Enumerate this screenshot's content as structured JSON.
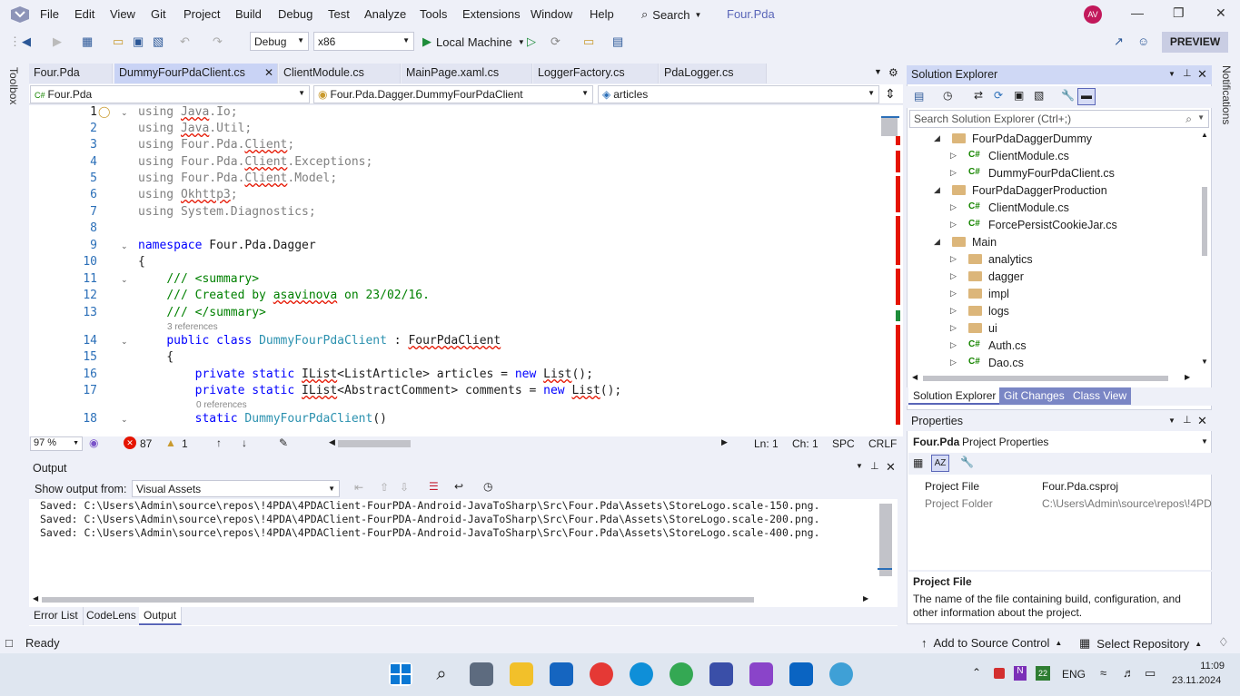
{
  "menubar": {
    "items": [
      "File",
      "Edit",
      "View",
      "Git",
      "Project",
      "Build",
      "Debug",
      "Test",
      "Analyze",
      "Tools",
      "Extensions",
      "Window",
      "Help"
    ],
    "search_label": "Search",
    "project_name": "Four.Pda"
  },
  "toolbar": {
    "config": "Debug",
    "platform": "x86",
    "run_target": "Local Machine",
    "preview_label": "PREVIEW"
  },
  "rails": {
    "toolbox": "Toolbox",
    "notifications": "Notifications"
  },
  "editor": {
    "tabs": [
      "Four.Pda",
      "DummyFourPdaClient.cs",
      "ClientModule.cs",
      "MainPage.xaml.cs",
      "LoggerFactory.cs",
      "PdaLogger.cs"
    ],
    "nav": {
      "project": "Four.Pda",
      "type": "Four.Pda.Dagger.DummyFourPdaClient",
      "member": "articles"
    },
    "references_3": "3 references",
    "references_0": "0 references",
    "status": {
      "zoom": "97 %",
      "errors": "87",
      "warnings": "1",
      "ln": "Ln: 1",
      "ch": "Ch: 1",
      "spc": "SPC",
      "crlf": "CRLF"
    }
  },
  "output": {
    "title": "Output",
    "show_from_label": "Show output from:",
    "source": "Visual Assets",
    "lines": [
      "Saved: C:\\Users\\Admin\\source\\repos\\!4PDA\\4PDAClient-FourPDA-Android-JavaToSharp\\Src\\Four.Pda\\Assets\\StoreLogo.scale-150.png.",
      "Saved: C:\\Users\\Admin\\source\\repos\\!4PDA\\4PDAClient-FourPDA-Android-JavaToSharp\\Src\\Four.Pda\\Assets\\StoreLogo.scale-200.png.",
      "Saved: C:\\Users\\Admin\\source\\repos\\!4PDA\\4PDAClient-FourPDA-Android-JavaToSharp\\Src\\Four.Pda\\Assets\\StoreLogo.scale-400.png."
    ],
    "tabs": [
      "Error List",
      "CodeLens",
      "Output"
    ]
  },
  "solution_explorer": {
    "title": "Solution Explorer",
    "search_placeholder": "Search Solution Explorer (Ctrl+;)",
    "tree": [
      {
        "label": "FourPdaDaggerDummy",
        "kind": "folder",
        "depth": 0,
        "open": true
      },
      {
        "label": "ClientModule.cs",
        "kind": "cs",
        "depth": 1
      },
      {
        "label": "DummyFourPdaClient.cs",
        "kind": "cs",
        "depth": 1
      },
      {
        "label": "FourPdaDaggerProduction",
        "kind": "folder",
        "depth": 0,
        "open": true
      },
      {
        "label": "ClientModule.cs",
        "kind": "cs",
        "depth": 1
      },
      {
        "label": "ForcePersistCookieJar.cs",
        "kind": "cs",
        "depth": 1
      },
      {
        "label": "Main",
        "kind": "folder",
        "depth": 0,
        "open": true
      },
      {
        "label": "analytics",
        "kind": "folder",
        "depth": 1
      },
      {
        "label": "dagger",
        "kind": "folder",
        "depth": 1
      },
      {
        "label": "impl",
        "kind": "folder",
        "depth": 1
      },
      {
        "label": "logs",
        "kind": "folder",
        "depth": 1
      },
      {
        "label": "ui",
        "kind": "folder",
        "depth": 1
      },
      {
        "label": "Auth.cs",
        "kind": "cs",
        "depth": 1
      },
      {
        "label": "Dao.cs",
        "kind": "cs",
        "depth": 1
      }
    ],
    "tabs": [
      "Solution Explorer",
      "Git Changes",
      "Class View"
    ]
  },
  "properties": {
    "title": "Properties",
    "object": "Four.Pda",
    "object_type": "Project Properties",
    "rows": [
      {
        "name": "Project File",
        "value": "Four.Pda.csproj"
      },
      {
        "name": "Project Folder",
        "value": "C:\\Users\\Admin\\source\\repos\\!4PD"
      }
    ],
    "desc_title": "Project File",
    "desc_text": "The name of the file containing build, configuration, and other information about the project."
  },
  "statusbar": {
    "ready": "Ready",
    "source_control": "Add to Source Control",
    "repository": "Select Repository"
  },
  "taskbar": {
    "lang": "ENG",
    "time": "11:09",
    "date": "23.11.2024",
    "badge": "22"
  }
}
